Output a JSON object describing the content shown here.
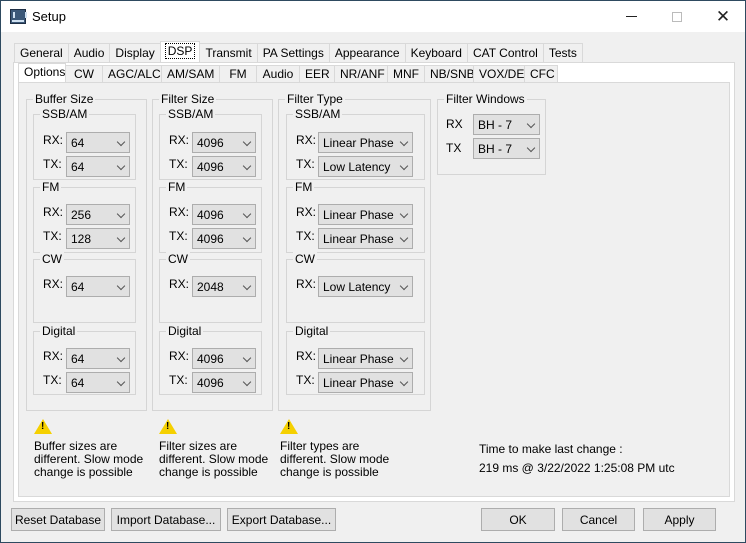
{
  "window": {
    "title": "Setup",
    "minimize": "minimize",
    "maximize": "maximize",
    "close": "close"
  },
  "top_tabs": [
    "General",
    "Audio",
    "Display",
    "DSP",
    "Transmit",
    "PA Settings",
    "Appearance",
    "Keyboard",
    "CAT Control",
    "Tests"
  ],
  "top_tabs_active": "DSP",
  "sub_tabs": [
    "Options",
    "CW",
    "AGC/ALC",
    "AM/SAM",
    "FM",
    "Audio",
    "EER",
    "NR/ANF",
    "MNF",
    "NB/SNB",
    "VOX/DE",
    "CFC"
  ],
  "sub_tabs_active": "Options",
  "labels": {
    "rx": "RX:",
    "tx": "TX:",
    "rx_plain": "RX",
    "tx_plain": "TX"
  },
  "buffer_size": {
    "title": "Buffer Size",
    "ssb_am": {
      "title": "SSB/AM",
      "rx": "64",
      "tx": "64"
    },
    "fm": {
      "title": "FM",
      "rx": "256",
      "tx": "128"
    },
    "cw": {
      "title": "CW",
      "rx": "64"
    },
    "digital": {
      "title": "Digital",
      "rx": "64",
      "tx": "64"
    }
  },
  "filter_size": {
    "title": "Filter Size",
    "ssb_am": {
      "title": "SSB/AM",
      "rx": "4096",
      "tx": "4096"
    },
    "fm": {
      "title": "FM",
      "rx": "4096",
      "tx": "4096"
    },
    "cw": {
      "title": "CW",
      "rx": "2048"
    },
    "digital": {
      "title": "Digital",
      "rx": "4096",
      "tx": "4096"
    }
  },
  "filter_type": {
    "title": "Filter Type",
    "ssb_am": {
      "title": "SSB/AM",
      "rx": "Linear Phase",
      "tx": "Low Latency"
    },
    "fm": {
      "title": "FM",
      "rx": "Linear Phase",
      "tx": "Linear Phase"
    },
    "cw": {
      "title": "CW",
      "rx": "Low Latency"
    },
    "digital": {
      "title": "Digital",
      "rx": "Linear Phase",
      "tx": "Linear Phase"
    }
  },
  "filter_windows": {
    "title": "Filter Windows",
    "rx": "BH - 7",
    "tx": "BH - 7"
  },
  "warnings": {
    "buffer": "Buffer sizes are different. Slow mode change is possible",
    "filter_size": "Filter sizes are different. Slow mode change is possible",
    "filter_type": "Filter types are different. Slow mode change is possible"
  },
  "timing": {
    "label": "Time to make last change :",
    "value": "219 ms @ 3/22/2022 1:25:08 PM utc"
  },
  "buttons": {
    "reset": "Reset Database",
    "import": "Import Database...",
    "export": "Export Database...",
    "ok": "OK",
    "cancel": "Cancel",
    "apply": "Apply"
  }
}
